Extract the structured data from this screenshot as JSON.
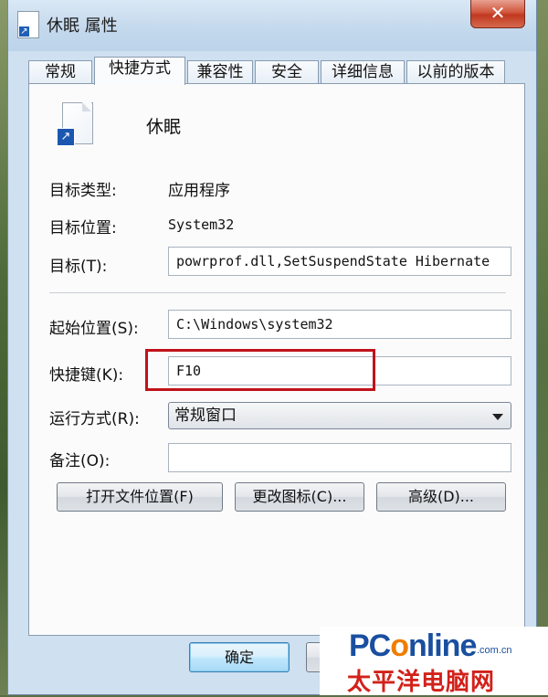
{
  "window": {
    "title": "休眠 属性",
    "close_symbol": "✕"
  },
  "tabs": [
    {
      "label": "常规"
    },
    {
      "label": "快捷方式"
    },
    {
      "label": "兼容性"
    },
    {
      "label": "安全"
    },
    {
      "label": "详细信息"
    },
    {
      "label": "以前的版本"
    }
  ],
  "active_tab": "快捷方式",
  "shortcut": {
    "name": "休眠",
    "target_type_label": "目标类型:",
    "target_type_value": "应用程序",
    "target_location_label": "目标位置:",
    "target_location_value": "System32",
    "target_label": "目标(T):",
    "target_value": "powrprof.dll,SetSuspendState Hibernate",
    "start_in_label": "起始位置(S):",
    "start_in_value": "C:\\Windows\\system32",
    "shortcut_key_label": "快捷键(K):",
    "shortcut_key_value": "F10",
    "run_label": "运行方式(R):",
    "run_value": "常规窗口",
    "comment_label": "备注(O):",
    "comment_value": ""
  },
  "buttons": {
    "open_location": "打开文件位置(F)",
    "change_icon": "更改图标(C)...",
    "advanced": "高级(D)...",
    "ok": "确定"
  },
  "watermark": {
    "logo_pc": "PC",
    "logo_o": "o",
    "logo_rest": "nline",
    "domain": ".com.cn",
    "chinese": "太平洋电脑网"
  },
  "colors": {
    "highlight_box": "#c0121a",
    "watermark_blue": "#1a4fa0",
    "watermark_red": "#d2211a"
  }
}
